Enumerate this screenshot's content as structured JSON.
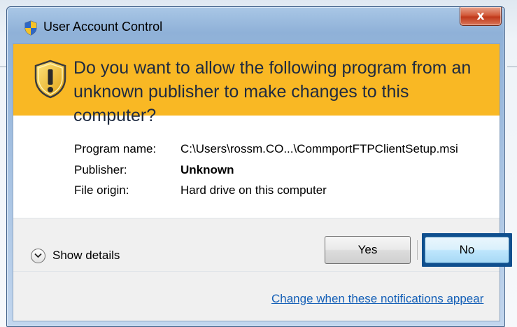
{
  "window": {
    "title": "User Account Control",
    "close_glyph": "x"
  },
  "banner": {
    "question": "Do you want to allow the following program from an unknown publisher to make changes to this computer?",
    "icon": "warning-shield-icon",
    "color": "#f9b824"
  },
  "details": {
    "program_name_label": "Program name:",
    "program_name_value": "C:\\Users\\rossm.CO...\\CommportFTPClientSetup.msi",
    "publisher_label": "Publisher:",
    "publisher_value": "Unknown",
    "file_origin_label": "File origin:",
    "file_origin_value": "Hard drive on this computer"
  },
  "footer": {
    "show_details_label": "Show details",
    "yes_label": "Yes",
    "no_label": "No",
    "notifications_link": "Change when these notifications appear"
  },
  "colors": {
    "link": "#1560b7",
    "focus_frame": "#0f4f8e"
  }
}
